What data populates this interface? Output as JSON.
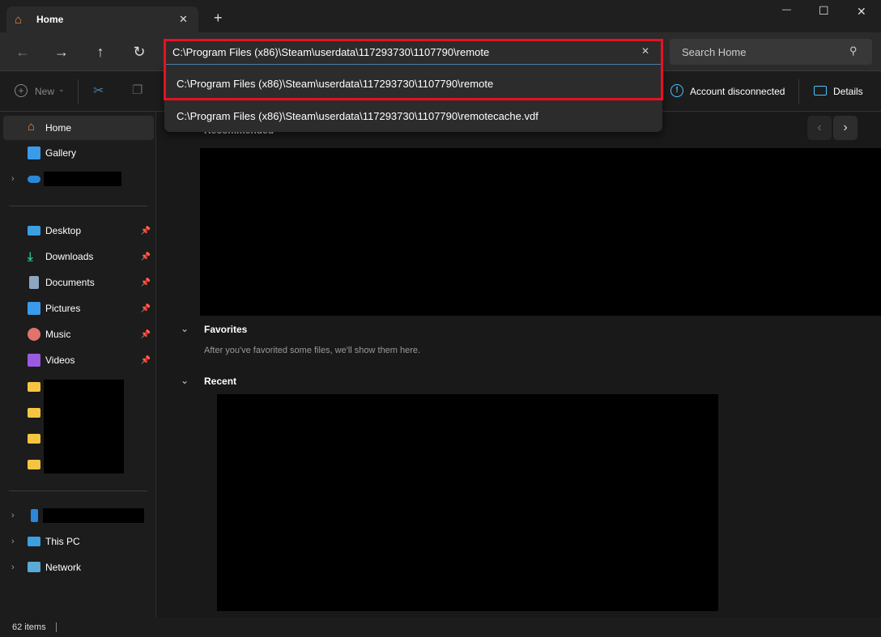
{
  "tab": {
    "title": "Home",
    "close": "✕",
    "new_tab": "+"
  },
  "window": {
    "minimize": "—",
    "maximize": "☐",
    "close": "✕"
  },
  "address": {
    "value": "C:\\Program Files (x86)\\Steam\\userdata\\117293730\\1107790\\remote",
    "clear": "✕",
    "suggestions": [
      "C:\\Program Files (x86)\\Steam\\userdata\\117293730\\1107790\\remote",
      "C:\\Program Files (x86)\\Steam\\userdata\\117293730\\1107790\\remotecache.vdf"
    ]
  },
  "search": {
    "placeholder": "Search Home"
  },
  "toolbar": {
    "new_label": "New",
    "account": "Account disconnected",
    "details": "Details"
  },
  "sidebar": {
    "items": [
      "Home",
      "Gallery",
      "Desktop",
      "Downloads",
      "Documents",
      "Pictures",
      "Music",
      "Videos",
      "This PC",
      "Network"
    ]
  },
  "main": {
    "recommended": "Recommended",
    "favorites": "Favorites",
    "favorites_empty": "After you've favorited some files, we'll show them here.",
    "recent": "Recent"
  },
  "status": {
    "count": "62 items"
  },
  "colors": {
    "highlight": "#e81123",
    "accent": "#4cc2ff"
  }
}
